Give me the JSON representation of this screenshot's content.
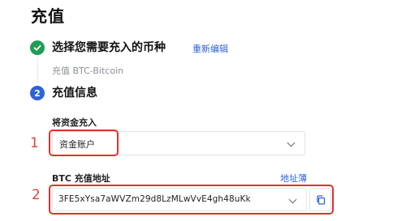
{
  "page": {
    "title": "充值"
  },
  "steps": [
    {
      "status": "completed",
      "title": "选择您需要充入的币种",
      "action_label": "重新编辑",
      "summary": "充值 BTC-Bitcoin"
    },
    {
      "status": "active",
      "number": "2",
      "title": "充值信息"
    }
  ],
  "form": {
    "account": {
      "label": "将资金充入",
      "value": "资金账户"
    },
    "address": {
      "label": "BTC 充值地址",
      "address_book_label": "地址薄",
      "value": "3FE5xYsa7aWVZm29d8LzMLwVvE4gh48uKk"
    }
  },
  "annotations": {
    "marker_1": "1",
    "marker_2": "2",
    "color": "#e0312b"
  },
  "colors": {
    "success": "#1f9d55",
    "primary": "#2d63d8"
  }
}
